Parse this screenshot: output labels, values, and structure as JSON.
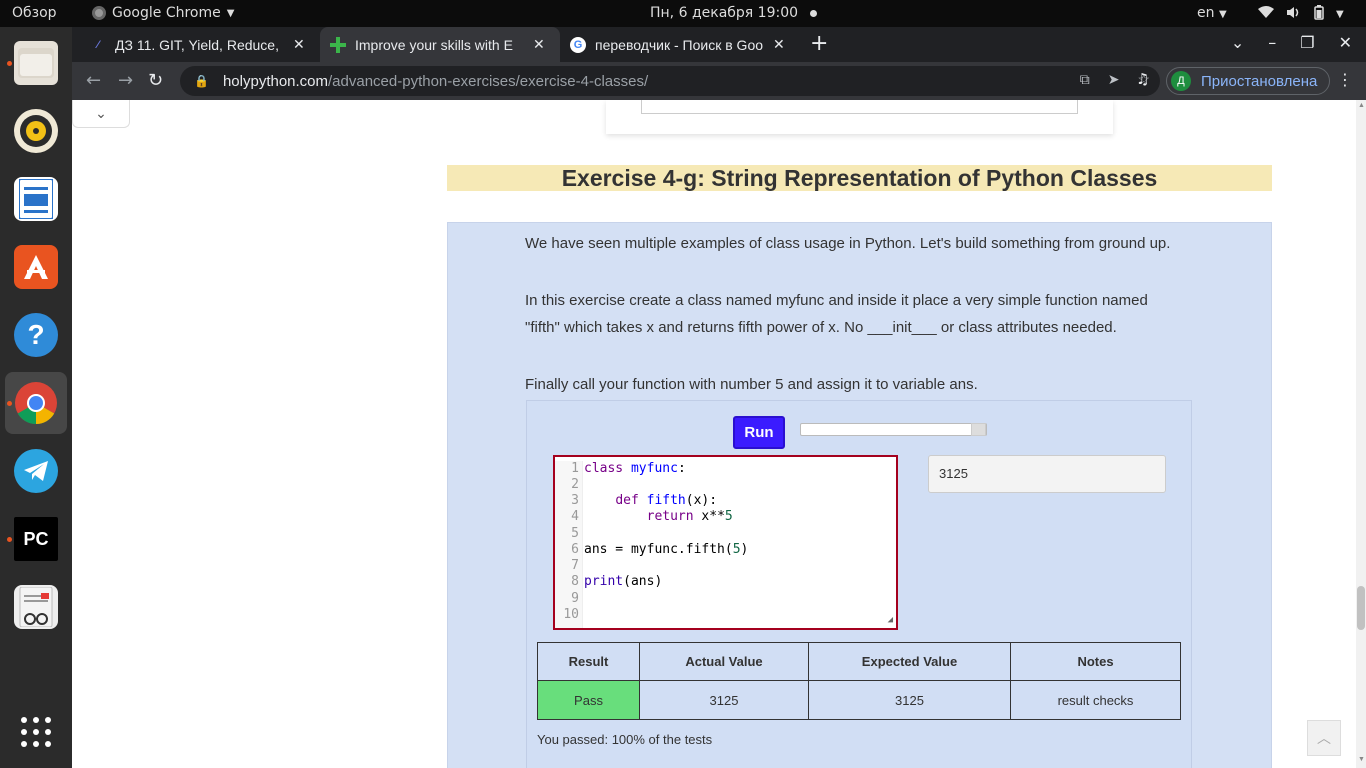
{
  "topbar": {
    "overview": "Обзор",
    "app_name": "Google Chrome",
    "datetime": "Пн, 6 декабря  19:00",
    "lang": "en"
  },
  "dock": {
    "items": [
      "files-icon",
      "rhythmbox-icon",
      "writer-icon",
      "software-center-icon",
      "help-icon",
      "chrome-icon",
      "telegram-icon",
      "pycharm-icon",
      "document-viewer-icon",
      "show-apps-icon"
    ]
  },
  "tabs": [
    {
      "title": "ДЗ 11. GIT, Yield, Reduce,",
      "close": "✕"
    },
    {
      "title": "Improve your skills with E",
      "close": "✕"
    },
    {
      "title": "переводчик - Поиск в Goo",
      "close": "✕"
    }
  ],
  "toolbar": {
    "url_host": "holypython.com",
    "url_path": "/advanced-python-exercises/exercise-4-classes/",
    "profile_initial": "Д",
    "profile_status": "Приостановлена"
  },
  "exercise": {
    "title": "Exercise 4-g: String Representation of Python Classes",
    "para1": "We have seen multiple examples of class usage in Python. Let's build something from ground up.",
    "para2": "In this exercise create a class named myfunc and inside it place a very simple function named \"fifth\" which takes x and returns fifth power of x. No ___init___ or class attributes needed.",
    "para3": "Finally call your function with number 5 and assign it to variable ans.",
    "run_label": "Run",
    "output": "3125"
  },
  "code_lines": [
    "1",
    "2",
    "3",
    "4",
    "5",
    "6",
    "7",
    "8",
    "9",
    "10"
  ],
  "results": {
    "headers": [
      "Result",
      "Actual Value",
      "Expected Value",
      "Notes"
    ],
    "row": [
      "Pass",
      "3125",
      "3125",
      "result checks"
    ],
    "summary": "You passed: 100% of the tests"
  },
  "colors": {
    "title_bg": "#f6e9b6",
    "box_bg": "#d4e0f4",
    "run_bg": "#3b1bff",
    "pass_bg": "#68de7c",
    "editor_border": "#a4001e"
  }
}
